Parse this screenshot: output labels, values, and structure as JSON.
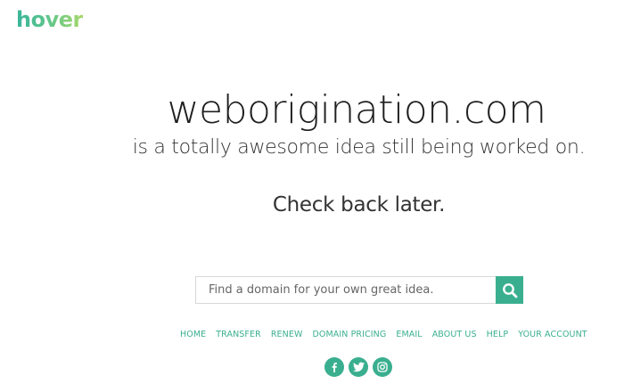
{
  "brand": {
    "logo_text": "hover"
  },
  "hero": {
    "domain": "weborigination.com",
    "tagline": "is a totally awesome idea still being worked on.",
    "status": "Check back later."
  },
  "search": {
    "placeholder": "Find a domain for your own great idea.",
    "button_icon": "search-icon"
  },
  "nav": {
    "items": [
      {
        "label": "HOME"
      },
      {
        "label": "TRANSFER"
      },
      {
        "label": "RENEW"
      },
      {
        "label": "DOMAIN PRICING"
      },
      {
        "label": "EMAIL"
      },
      {
        "label": "ABOUT US"
      },
      {
        "label": "HELP"
      },
      {
        "label": "YOUR ACCOUNT"
      }
    ]
  },
  "social": [
    {
      "icon": "facebook-icon"
    },
    {
      "icon": "twitter-icon"
    },
    {
      "icon": "instagram-icon"
    }
  ],
  "colors": {
    "accent": "#3aaf8f",
    "text": "#222222"
  }
}
